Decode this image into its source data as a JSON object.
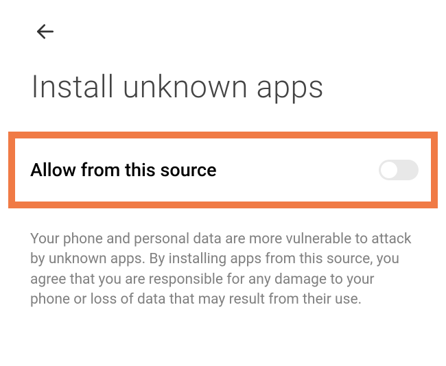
{
  "header": {
    "title": "Install unknown apps"
  },
  "setting": {
    "label": "Allow from this source",
    "toggle_state": "off"
  },
  "description": {
    "text": "Your phone and personal data are more vulnerable to attack by unknown apps. By installing apps from this source, you agree that you are responsible for any damage to your phone or loss of data that may result from their use."
  },
  "colors": {
    "highlight_border": "#f07a45"
  }
}
